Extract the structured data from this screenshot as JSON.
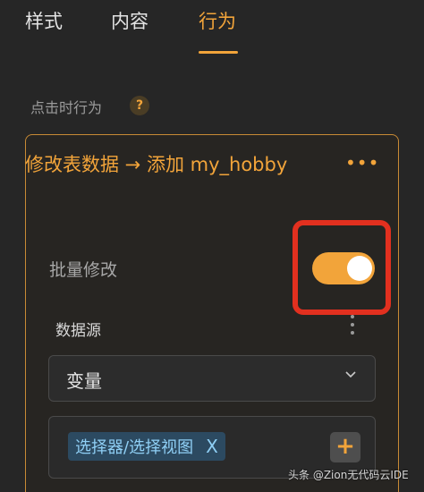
{
  "tabs": [
    {
      "label": "样式"
    },
    {
      "label": "内容"
    },
    {
      "label": "行为"
    }
  ],
  "active_tab": "行为",
  "colors": {
    "accent": "#f2a43a",
    "highlight": "#e2301f",
    "tag_bg": "#2c4a61",
    "tag_text": "#8fcff5"
  },
  "section": {
    "label": "点击时行为",
    "help_icon": "?"
  },
  "action": {
    "title": "修改表数据 → 添加 my_hobby",
    "more_icon": "•••",
    "batch_modify": {
      "label": "批量修改",
      "enabled": true
    },
    "datasource": {
      "label": "数据源",
      "selected": "变量"
    },
    "selector": {
      "tag": "选择器/选择视图",
      "remove_icon": "X",
      "add_icon": "+"
    }
  },
  "watermark": "头条 @Zion无代码云IDE"
}
